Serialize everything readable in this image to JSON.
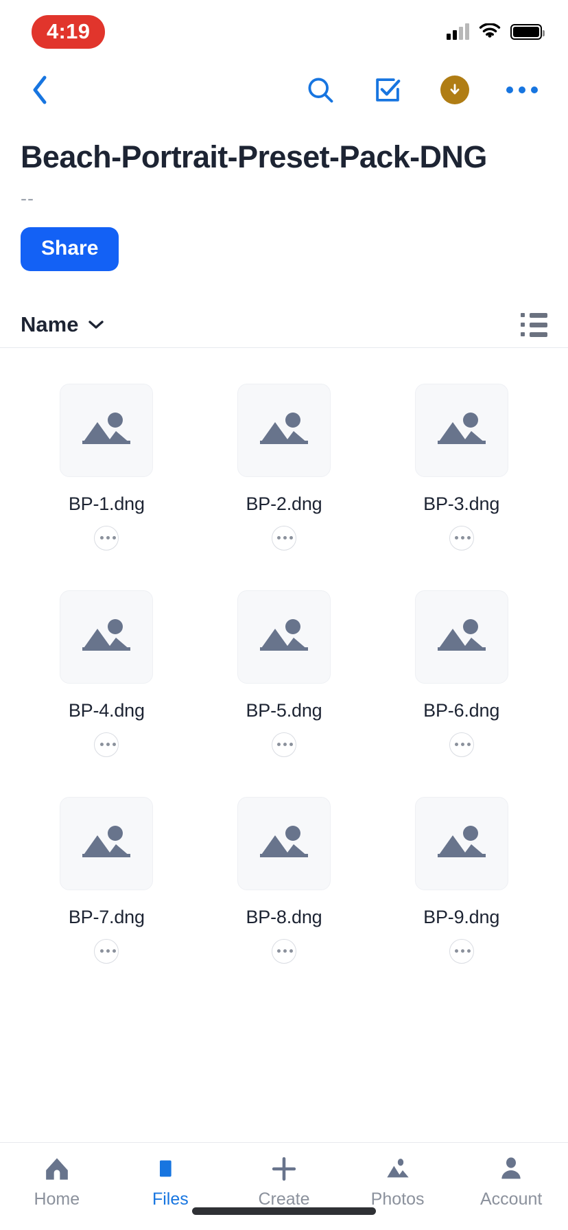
{
  "status_bar": {
    "time": "4:19",
    "time_pill_color": "#e1352c",
    "cellular_icon": "cellular-signal-icon",
    "wifi_icon": "wifi-icon",
    "battery_icon": "battery-icon"
  },
  "toolbar": {
    "back_icon": "chevron-left-icon",
    "search_icon": "search-icon",
    "select_icon": "checkbox-select-icon",
    "download_icon": "download-icon",
    "overflow_icon": "more-horizontal-icon",
    "accent_color": "#1775e0",
    "download_badge_color": "#b07d14"
  },
  "header": {
    "title": "Beach-Portrait-Preset-Pack-DNG",
    "subtitle": "--",
    "share_label": "Share",
    "share_color": "#1361f5"
  },
  "sort_bar": {
    "sort_label": "Name",
    "chevron_icon": "chevron-down-icon",
    "view_toggle_icon": "list-view-icon"
  },
  "files": [
    {
      "name": "BP-1.dng",
      "thumb_icon": "image-placeholder-icon",
      "more_icon": "more-horizontal-icon"
    },
    {
      "name": "BP-2.dng",
      "thumb_icon": "image-placeholder-icon",
      "more_icon": "more-horizontal-icon"
    },
    {
      "name": "BP-3.dng",
      "thumb_icon": "image-placeholder-icon",
      "more_icon": "more-horizontal-icon"
    },
    {
      "name": "BP-4.dng",
      "thumb_icon": "image-placeholder-icon",
      "more_icon": "more-horizontal-icon"
    },
    {
      "name": "BP-5.dng",
      "thumb_icon": "image-placeholder-icon",
      "more_icon": "more-horizontal-icon"
    },
    {
      "name": "BP-6.dng",
      "thumb_icon": "image-placeholder-icon",
      "more_icon": "more-horizontal-icon"
    },
    {
      "name": "BP-7.dng",
      "thumb_icon": "image-placeholder-icon",
      "more_icon": "more-horizontal-icon"
    },
    {
      "name": "BP-8.dng",
      "thumb_icon": "image-placeholder-icon",
      "more_icon": "more-horizontal-icon"
    },
    {
      "name": "BP-9.dng",
      "thumb_icon": "image-placeholder-icon",
      "more_icon": "more-horizontal-icon"
    }
  ],
  "tab_bar": {
    "active": "Files",
    "active_color": "#1775e0",
    "inactive_color": "#8b919c",
    "items": [
      {
        "label": "Home",
        "icon": "home-icon"
      },
      {
        "label": "Files",
        "icon": "folder-icon"
      },
      {
        "label": "Create",
        "icon": "plus-icon"
      },
      {
        "label": "Photos",
        "icon": "photos-icon"
      },
      {
        "label": "Account",
        "icon": "person-icon"
      }
    ]
  }
}
